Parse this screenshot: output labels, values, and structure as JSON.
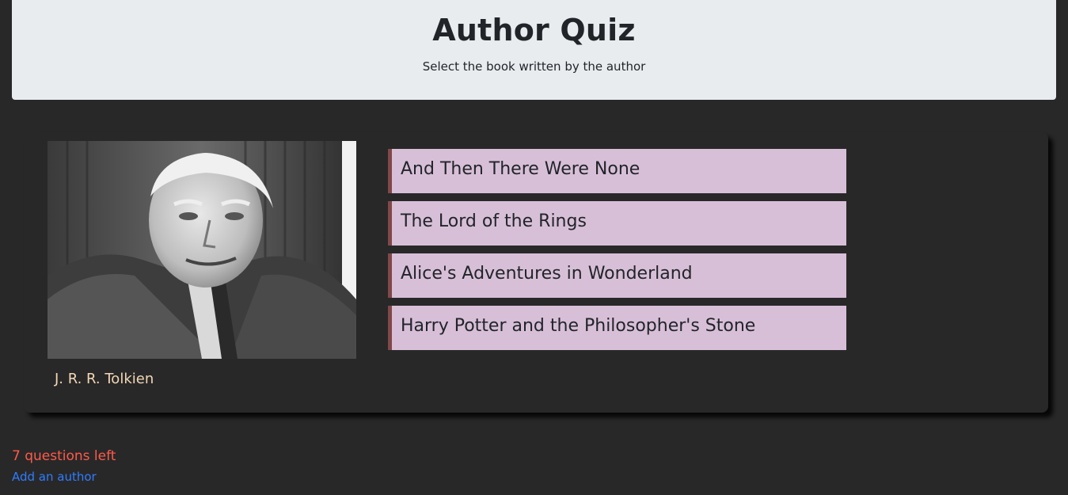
{
  "header": {
    "title": "Author Quiz",
    "subtitle": "Select the book written by the author"
  },
  "turn": {
    "author_name": "J. R. R. Tolkien",
    "author_image": "author-portrait",
    "answers": [
      "And Then There Were None",
      "The Lord of the Rings",
      "Alice's Adventures in Wonderland",
      "Harry Potter and the Philosopher's Stone"
    ]
  },
  "footer": {
    "questions_left": "7 questions left",
    "add_author_link": "Add an author"
  },
  "colors": {
    "page_background": "#282828",
    "header_background": "#e9ecef",
    "answer_background": "#d8bfd8",
    "answer_border": "#804848",
    "author_name": "#f3d7b5",
    "questions_left": "#ff5a4a",
    "link": "#2f7cff"
  }
}
